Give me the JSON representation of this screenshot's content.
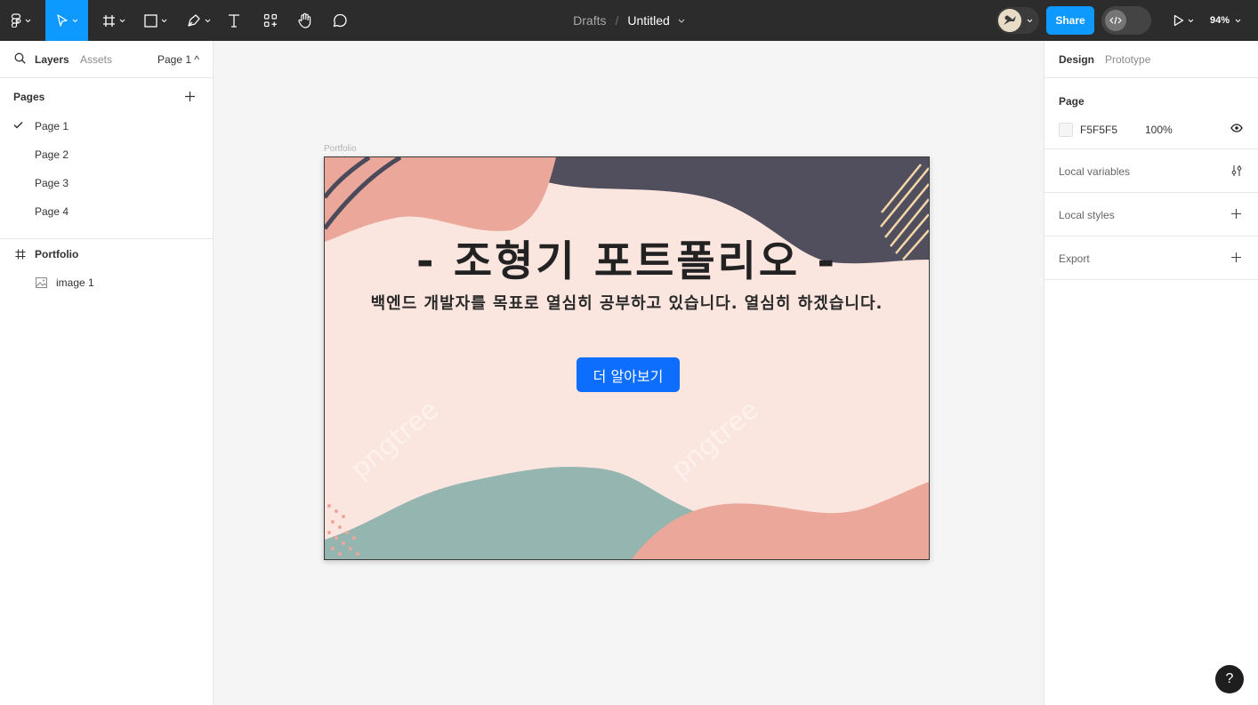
{
  "toolbar": {
    "breadcrumb_parent": "Drafts",
    "breadcrumb_separator": "/",
    "file_title": "Untitled",
    "share_label": "Share",
    "zoom_label": "94%",
    "accent_color": "#0d99ff"
  },
  "left_panel": {
    "tabs": {
      "layers": "Layers",
      "assets": "Assets",
      "page_selector": "Page 1 ^"
    },
    "pages_title": "Pages",
    "pages": [
      "Page 1",
      "Page 2",
      "Page 3",
      "Page 4"
    ],
    "selected_page": "Page 1",
    "layers": [
      {
        "label": "Portfolio",
        "icon": "frame-icon"
      },
      {
        "label": "image 1",
        "icon": "image-icon"
      }
    ]
  },
  "right_panel": {
    "tabs": {
      "design": "Design",
      "prototype": "Prototype"
    },
    "page_section": {
      "title": "Page",
      "color_hex": "F5F5F5",
      "opacity": "100%"
    },
    "rows": [
      {
        "label": "Local variables",
        "icon": "sliders-icon"
      },
      {
        "label": "Local styles",
        "icon": "plus-icon"
      },
      {
        "label": "Export",
        "icon": "plus-icon"
      }
    ]
  },
  "canvas": {
    "frame_label": "Portfolio",
    "hero_title": "- 조형기 포트폴리오 -",
    "hero_subtitle": "백엔드 개발자를 목표로 열심히 공부하고 있습니다. 열심히 하겠습니다.",
    "hero_button": "더 알아보기",
    "watermark": "pngtree",
    "button_color": "#0d6efd"
  },
  "help_label": "?"
}
